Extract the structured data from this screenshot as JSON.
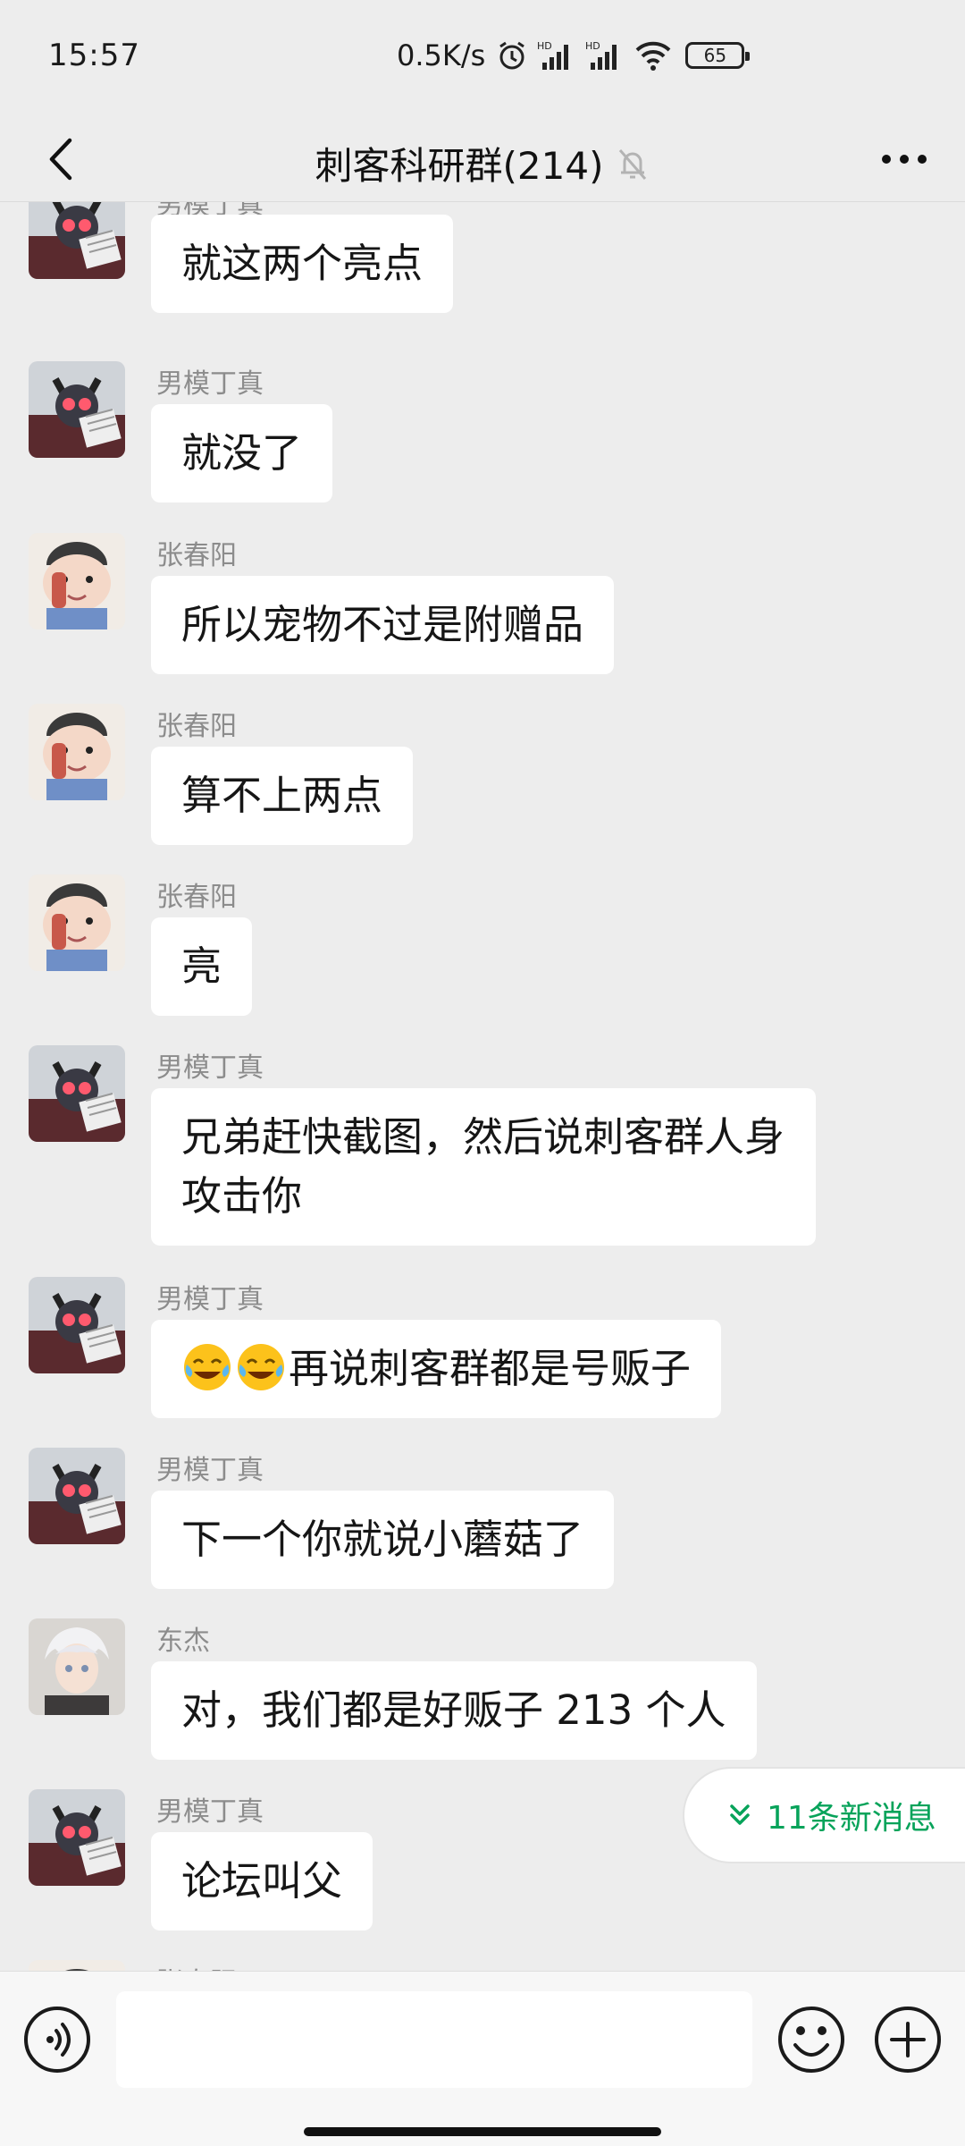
{
  "status_bar": {
    "time": "15:57",
    "net_speed": "0.5K/s",
    "battery": "65"
  },
  "header": {
    "title": "刺客科研群(214)"
  },
  "messages": [
    {
      "sender": "男模丁真",
      "text": "就这两个亮点",
      "avatar": "demon-reader"
    },
    {
      "sender": "男模丁真",
      "text": "就没了",
      "avatar": "demon-reader"
    },
    {
      "sender": "张春阳",
      "text": "所以宠物不过是附赠品",
      "avatar": "cartoon-boy"
    },
    {
      "sender": "张春阳",
      "text": "算不上两点",
      "avatar": "cartoon-boy"
    },
    {
      "sender": "张春阳",
      "text": "亮",
      "avatar": "cartoon-boy"
    },
    {
      "sender": "男模丁真",
      "text": "兄弟赶快截图，然后说刺客群人身攻击你",
      "avatar": "demon-reader"
    },
    {
      "sender": "男模丁真",
      "text": "再说刺客群都是号贩子",
      "emoji_prefix": "😂😂",
      "avatar": "demon-reader"
    },
    {
      "sender": "男模丁真",
      "text": "下一个你就说小蘑菇了",
      "avatar": "demon-reader"
    },
    {
      "sender": "东杰",
      "text": "对，我们都是好贩子 213 个人",
      "avatar": "anime-white-hair"
    },
    {
      "sender": "男模丁真",
      "text": "论坛叫父",
      "avatar": "demon-reader"
    },
    {
      "sender": "张春阳",
      "text": "",
      "avatar": "cartoon-boy"
    }
  ],
  "new_messages": {
    "label": "11条新消息"
  },
  "input": {
    "placeholder": ""
  },
  "colors": {
    "background": "#ededed",
    "bubble": "#ffffff",
    "accent_green": "#07a35a"
  }
}
